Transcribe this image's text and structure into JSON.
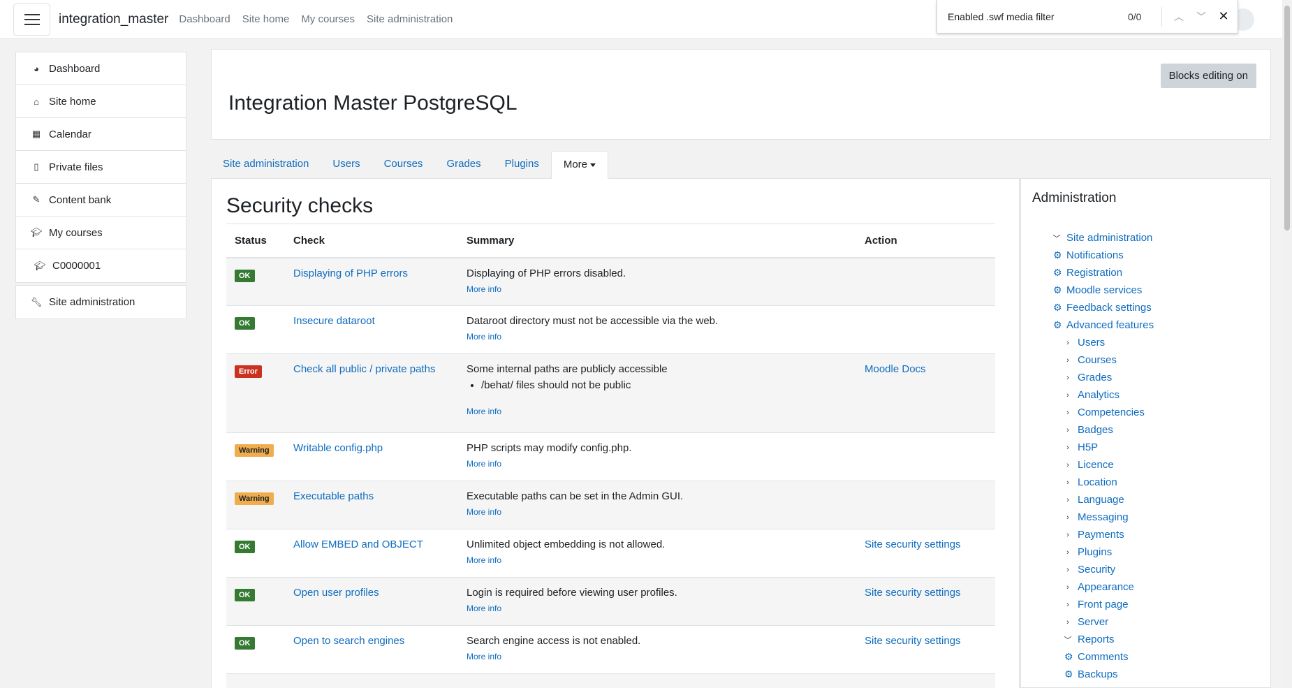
{
  "navbar": {
    "site_name": "integration_master",
    "links": [
      "Dashboard",
      "Site home",
      "My courses",
      "Site administration"
    ]
  },
  "findbar": {
    "query": "Enabled .swf media filter",
    "count": "0/0"
  },
  "drawer": {
    "items": [
      {
        "label": "Dashboard",
        "icon": "dashboard-icon"
      },
      {
        "label": "Site home",
        "icon": "home-icon"
      },
      {
        "label": "Calendar",
        "icon": "calendar-icon"
      },
      {
        "label": "Private files",
        "icon": "file-icon"
      },
      {
        "label": "Content bank",
        "icon": "brush-icon"
      },
      {
        "label": "My courses",
        "icon": "graduation-cap-icon"
      },
      {
        "label": "C0000001",
        "icon": "graduation-cap-icon"
      }
    ],
    "admin_item": {
      "label": "Site administration",
      "icon": "wrench-icon"
    }
  },
  "header": {
    "title": "Integration Master PostgreSQL",
    "blocks_button": "Blocks editing on"
  },
  "tabs": [
    "Site administration",
    "Users",
    "Courses",
    "Grades",
    "Plugins",
    "More"
  ],
  "main": {
    "heading": "Security checks",
    "columns": [
      "Status",
      "Check",
      "Summary",
      "Action"
    ],
    "more_info": "More info",
    "rows": [
      {
        "status": "OK",
        "check": "Displaying of PHP errors",
        "summary": "Displaying of PHP errors disabled.",
        "action": ""
      },
      {
        "status": "OK",
        "check": "Insecure dataroot",
        "summary": "Dataroot directory must not be accessible via the web.",
        "action": ""
      },
      {
        "status": "Error",
        "check": "Check all public / private paths",
        "summary": "Some internal paths are publicly accessible",
        "detail": "/behat/ files should not be public",
        "action": "Moodle Docs"
      },
      {
        "status": "Warning",
        "check": "Writable config.php",
        "summary": "PHP scripts may modify config.php.",
        "action": ""
      },
      {
        "status": "Warning",
        "check": "Executable paths",
        "summary": "Executable paths can be set in the Admin GUI.",
        "action": ""
      },
      {
        "status": "OK",
        "check": "Allow EMBED and OBJECT",
        "summary": "Unlimited object embedding is not allowed.",
        "action": "Site security settings"
      },
      {
        "status": "OK",
        "check": "Open user profiles",
        "summary": "Login is required before viewing user profiles.",
        "action": "Site security settings"
      },
      {
        "status": "OK",
        "check": "Open to search engines",
        "summary": "Search engine access is not enabled.",
        "action": "Site security settings"
      }
    ]
  },
  "admin_block": {
    "title": "Administration",
    "root": "Site administration",
    "settings": [
      "Notifications",
      "Registration",
      "Moodle services",
      "Feedback settings",
      "Advanced features"
    ],
    "categories": [
      "Users",
      "Courses",
      "Grades",
      "Analytics",
      "Competencies",
      "Badges",
      "H5P",
      "Licence",
      "Location",
      "Language",
      "Messaging",
      "Payments",
      "Plugins",
      "Security",
      "Appearance",
      "Front page",
      "Server"
    ],
    "reports_label": "Reports",
    "reports_children": [
      "Comments",
      "Backups"
    ]
  },
  "colors": {
    "link": "#0f6cbf",
    "ok": "#357a32",
    "error": "#ca3120",
    "warning": "#f0ad4e"
  }
}
